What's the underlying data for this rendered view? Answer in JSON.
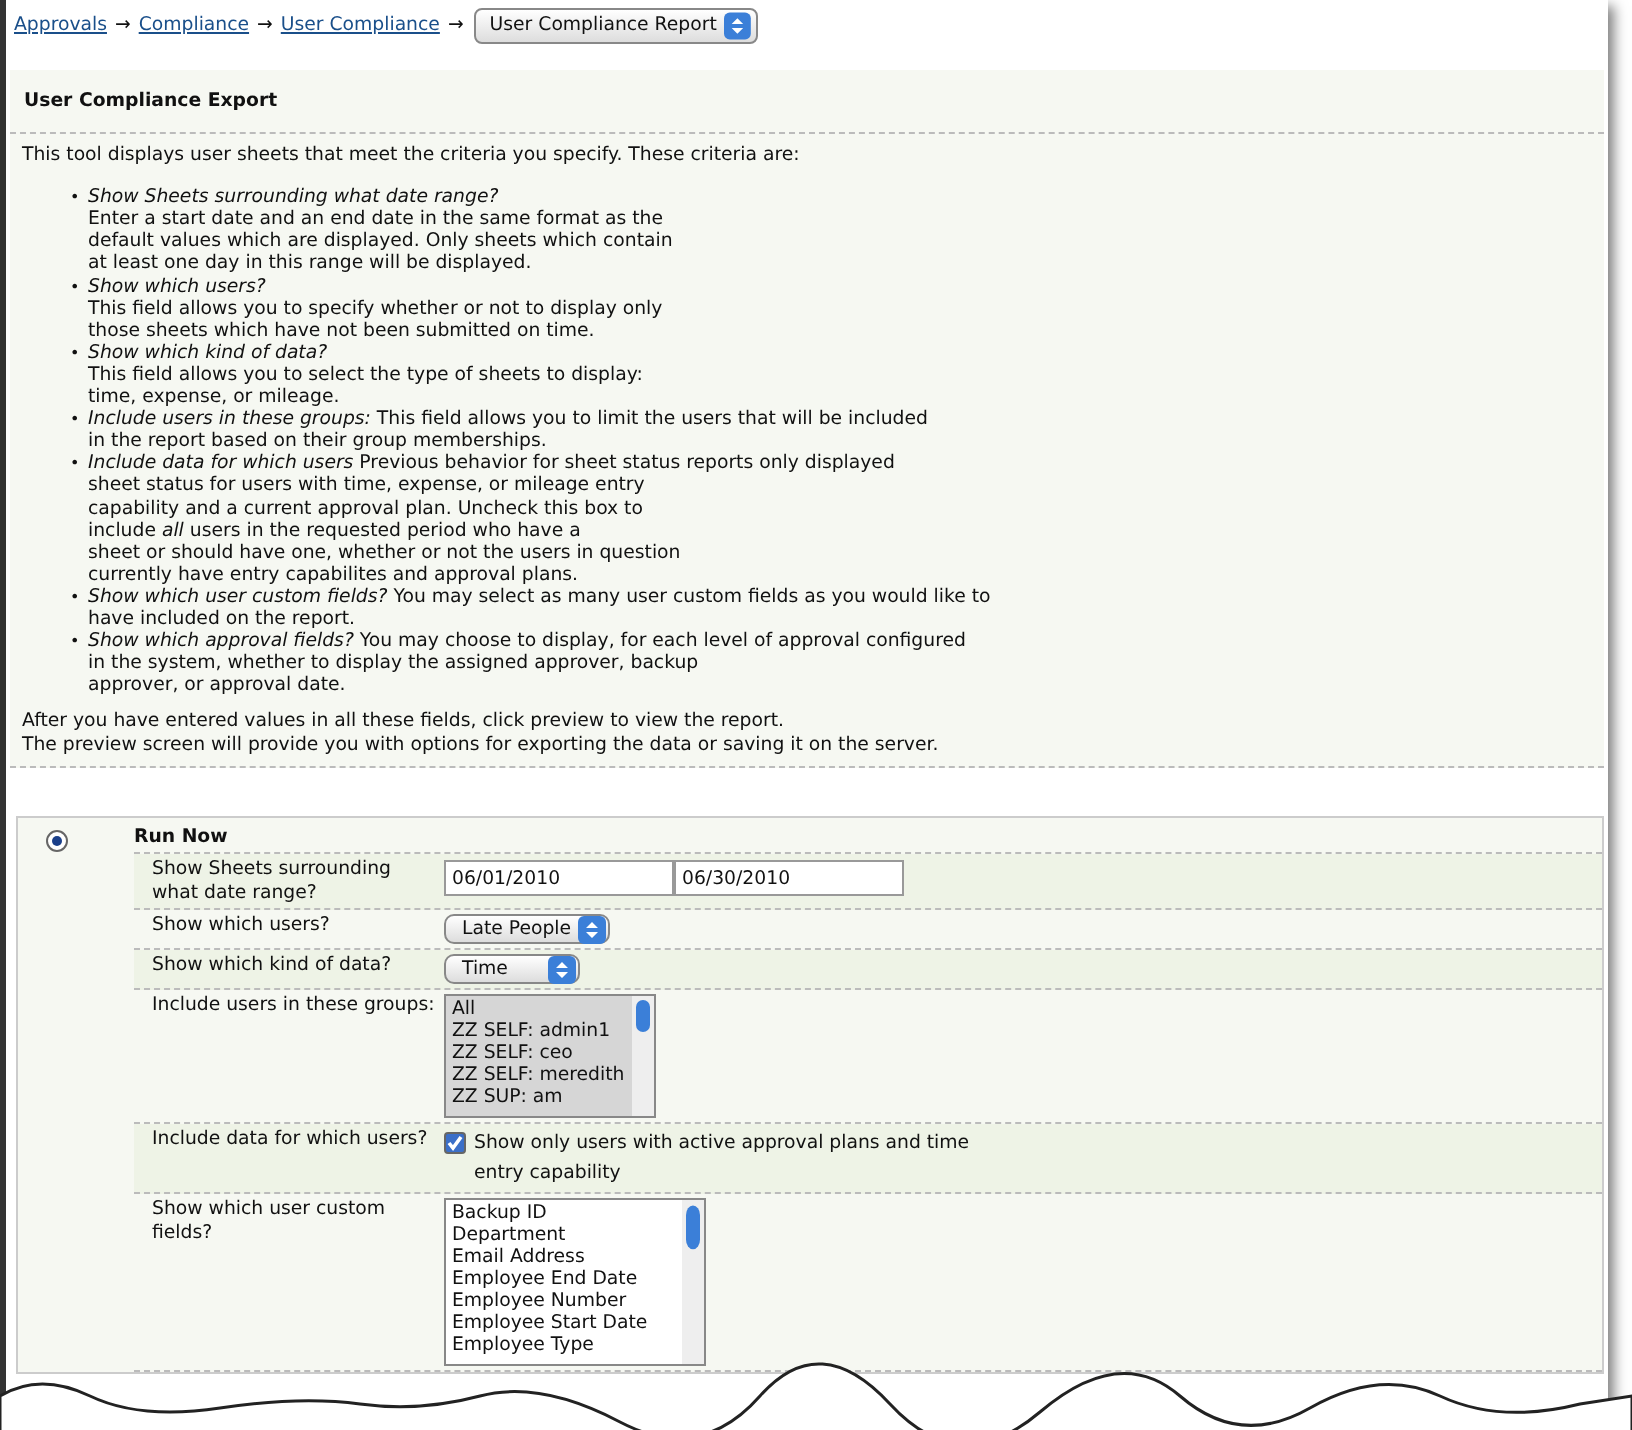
{
  "breadcrumb": {
    "links": [
      "Approvals",
      "Compliance",
      "User Compliance"
    ],
    "separator": "→",
    "current": "User Compliance Report"
  },
  "title": "User Compliance Export",
  "bullet": "•",
  "intro": "This tool displays user sheets that meet the criteria you specify. These criteria are:",
  "criteria": [
    {
      "lines": [
        "*Show Sheets surrounding what date range?*",
        "Enter a start date and an end date in the same format as the",
        "default values which are displayed. Only sheets which contain",
        "at least one day in this range will be displayed."
      ]
    },
    {
      "lines": [
        "*Show which users?*",
        "This field allows you to specify whether or not to display only",
        "those sheets which have not been submitted on time."
      ]
    },
    {
      "lines": [
        "*Show which kind of data?*",
        "This field allows you to select the type of sheets to display:",
        "time, expense, or mileage."
      ]
    },
    {
      "lines": [
        "*Include users in these groups:* This field allows you to limit the users that will be included",
        "in the report based on their group memberships."
      ]
    },
    {
      "lines": [
        "*Include data for which users* Previous behavior for sheet status reports only displayed",
        "sheet status for users with time, expense, or mileage entry",
        "capability and a current approval plan. Uncheck this box to",
        "include *all* users in the requested period who have a",
        "sheet or should have one, whether or not the users in question",
        "currently have entry capabilites and approval plans."
      ]
    },
    {
      "lines": [
        "*Show which user custom fields?* You may select as many user custom fields as you would like to",
        "have included on the report."
      ]
    },
    {
      "lines": [
        "*Show which approval fields?* You may choose to display, for each level of approval configured",
        "in the system, whether to display the assigned approver, backup",
        "approver, or approval date."
      ]
    }
  ],
  "outro": [
    "After you have entered values in all these fields, click preview to view the report.",
    "The preview screen will provide you with options for exporting the data or saving it on the server."
  ],
  "run_now": {
    "label": "Run Now",
    "selected": true
  },
  "rows": [
    {
      "kind": "date_range",
      "label": "Show Sheets surrounding what date range?",
      "start": "06/01/2010",
      "end": "06/30/2010"
    },
    {
      "kind": "select",
      "label": "Show which users?",
      "value": "Late People"
    },
    {
      "kind": "select",
      "label": "Show which kind of data?",
      "value": "Time"
    },
    {
      "kind": "listbox",
      "label": "Include users in these groups:",
      "items": [
        {
          "text": "All",
          "selected": true
        },
        {
          "text": "ZZ SELF: admin1",
          "selected": true
        },
        {
          "text": "ZZ SELF: ceo",
          "selected": true
        },
        {
          "text": "ZZ SELF: meredith",
          "selected": true
        },
        {
          "text": "ZZ SUP: am",
          "selected": true
        }
      ]
    },
    {
      "kind": "checkbox",
      "label": "Include data for which users?",
      "checked": true,
      "text": "Show only users with active approval plans and time entry capability"
    },
    {
      "kind": "listbox",
      "label": "Show which user custom fields?",
      "items": [
        {
          "text": "Backup ID",
          "selected": false
        },
        {
          "text": "Department",
          "selected": false
        },
        {
          "text": "Email Address",
          "selected": false
        },
        {
          "text": "Employee End Date",
          "selected": false
        },
        {
          "text": "Employee Number",
          "selected": false
        },
        {
          "text": "Employee Start Date",
          "selected": false
        },
        {
          "text": "Employee Type",
          "selected": false
        }
      ]
    }
  ]
}
